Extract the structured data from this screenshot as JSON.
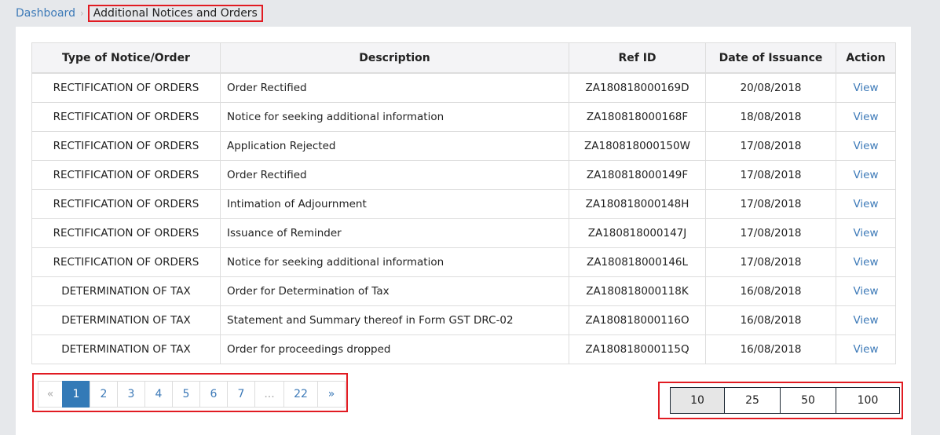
{
  "breadcrumb": {
    "home": "Dashboard",
    "separator": "›",
    "current": "Additional Notices and Orders"
  },
  "table": {
    "headers": [
      "Type of Notice/Order",
      "Description",
      "Ref ID",
      "Date of Issuance",
      "Action"
    ],
    "rows": [
      {
        "type": "RECTIFICATION OF ORDERS",
        "description": "Order Rectified",
        "ref_id": "ZA180818000169D",
        "date": "20/08/2018",
        "action": "View"
      },
      {
        "type": "RECTIFICATION OF ORDERS",
        "description": "Notice for seeking additional information",
        "ref_id": "ZA180818000168F",
        "date": "18/08/2018",
        "action": "View"
      },
      {
        "type": "RECTIFICATION OF ORDERS",
        "description": "Application Rejected",
        "ref_id": "ZA180818000150W",
        "date": "17/08/2018",
        "action": "View"
      },
      {
        "type": "RECTIFICATION OF ORDERS",
        "description": "Order Rectified",
        "ref_id": "ZA180818000149F",
        "date": "17/08/2018",
        "action": "View"
      },
      {
        "type": "RECTIFICATION OF ORDERS",
        "description": "Intimation of Adjournment",
        "ref_id": "ZA180818000148H",
        "date": "17/08/2018",
        "action": "View"
      },
      {
        "type": "RECTIFICATION OF ORDERS",
        "description": "Issuance of Reminder",
        "ref_id": "ZA180818000147J",
        "date": "17/08/2018",
        "action": "View"
      },
      {
        "type": "RECTIFICATION OF ORDERS",
        "description": "Notice for seeking additional information",
        "ref_id": "ZA180818000146L",
        "date": "17/08/2018",
        "action": "View"
      },
      {
        "type": "DETERMINATION OF TAX",
        "description": "Order for Determination of Tax",
        "ref_id": "ZA180818000118K",
        "date": "16/08/2018",
        "action": "View"
      },
      {
        "type": "DETERMINATION OF TAX",
        "description": "Statement and Summary thereof in Form GST DRC-02",
        "ref_id": "ZA180818000116O",
        "date": "16/08/2018",
        "action": "View"
      },
      {
        "type": "DETERMINATION OF TAX",
        "description": "Order for proceedings dropped",
        "ref_id": "ZA180818000115Q",
        "date": "16/08/2018",
        "action": "View"
      }
    ]
  },
  "pagination": {
    "prev": "«",
    "pages": [
      "1",
      "2",
      "3",
      "4",
      "5",
      "6",
      "7",
      "...",
      "22"
    ],
    "active_page": "1",
    "next": "»"
  },
  "page_size": {
    "options": [
      "10",
      "25",
      "50",
      "100"
    ],
    "selected": "10"
  },
  "colors": {
    "accent": "#337ab7",
    "link": "#3d7ab8",
    "highlight_border": "#e11b22"
  }
}
